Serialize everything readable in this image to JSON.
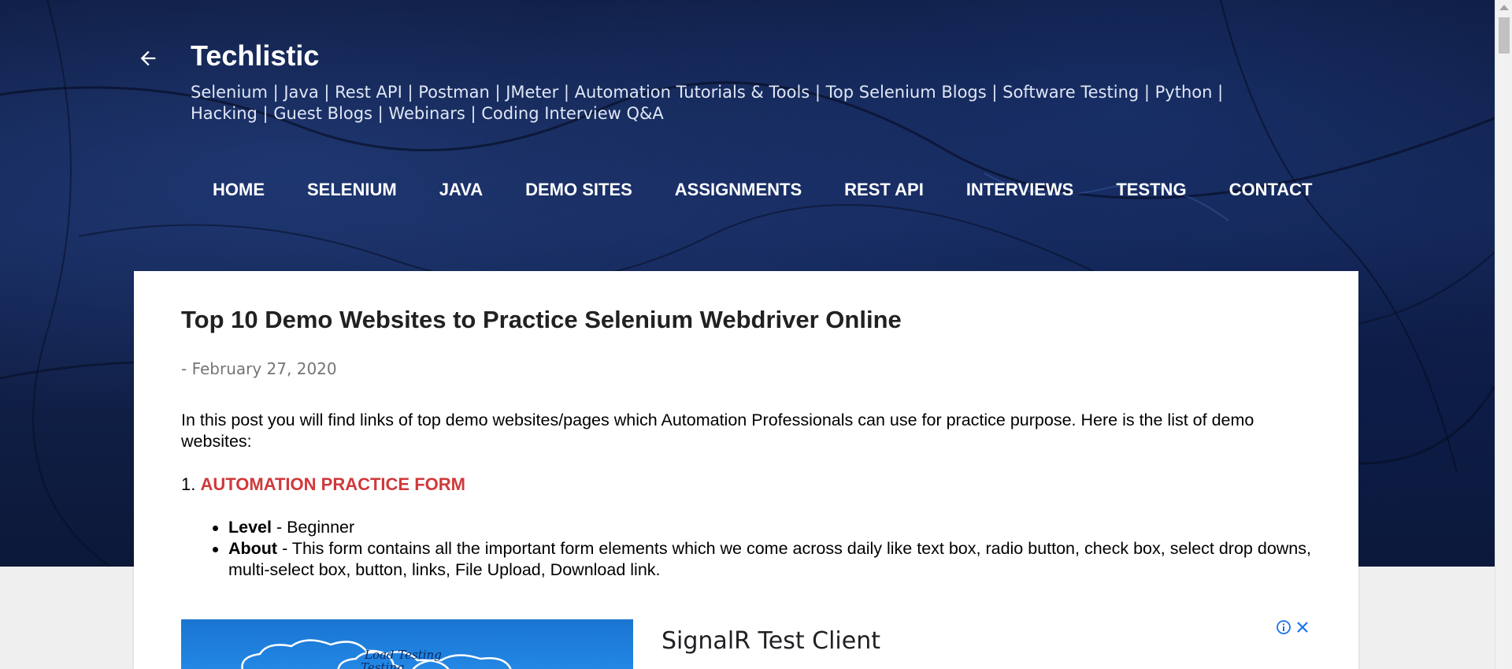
{
  "header": {
    "title": "Techlistic",
    "description": "Selenium | Java | Rest API | Postman | JMeter | Automation Tutorials & Tools | Top Selenium Blogs | Software Testing | Python | Hacking | Guest Blogs | Webinars | Coding Interview Q&A",
    "back_icon": "arrow-left-icon"
  },
  "nav": {
    "items": [
      {
        "label": "HOME"
      },
      {
        "label": "SELENIUM"
      },
      {
        "label": "JAVA"
      },
      {
        "label": "DEMO SITES"
      },
      {
        "label": "ASSIGNMENTS"
      },
      {
        "label": "REST API"
      },
      {
        "label": "INTERVIEWS"
      },
      {
        "label": "TESTNG"
      },
      {
        "label": "CONTACT"
      }
    ]
  },
  "post": {
    "title": "Top 10 Demo Websites to Practice Selenium Webdriver Online",
    "date": "- February 27, 2020",
    "intro": "In this post you will find links of top demo websites/pages which Automation Professionals can use for practice purpose. Here is the list of demo websites:",
    "section": {
      "number": "1. ",
      "link_text": "AUTOMATION PRACTICE FORM"
    },
    "bullets": [
      {
        "label": "Level",
        "text": " - Beginner"
      },
      {
        "label": "About",
        "text": " - This form contains all the important form elements which we come across daily like text box, radio button, check box, select drop downs, multi-select box, button, links, File Upload, Download link."
      }
    ]
  },
  "ad": {
    "title": "SignalR Test Client",
    "image_text": "Load Testing",
    "info_icon": "info-icon",
    "close_icon": "close-icon"
  },
  "colors": {
    "link_red": "#d0393b",
    "header_bg": "#142654",
    "ad_blue": "#1a75d1"
  }
}
